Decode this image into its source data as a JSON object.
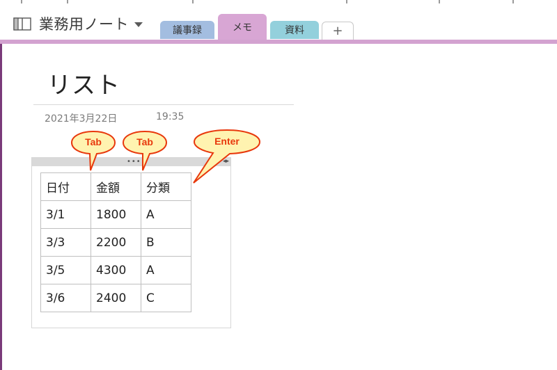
{
  "notebook": {
    "title": "業務用ノート"
  },
  "tabs": [
    {
      "label": "議事録"
    },
    {
      "label": "メモ"
    },
    {
      "label": "資料"
    },
    {
      "label": "+"
    }
  ],
  "page": {
    "title": "リスト",
    "date": "2021年3月22日",
    "time": "19:35"
  },
  "table": {
    "rows": [
      [
        "日付",
        "金額",
        "分類"
      ],
      [
        "3/1",
        "1800",
        "A"
      ],
      [
        "3/3",
        "2200",
        "B"
      ],
      [
        "3/5",
        "4300",
        "A"
      ],
      [
        "3/6",
        "2400",
        "C"
      ]
    ]
  },
  "callouts": [
    {
      "label": "Tab"
    },
    {
      "label": "Tab"
    },
    {
      "label": "Enter"
    }
  ],
  "colors": {
    "section_accent": "#d3a2d0",
    "callout_fill": "#fff3b0",
    "callout_stroke": "#e8380c"
  }
}
